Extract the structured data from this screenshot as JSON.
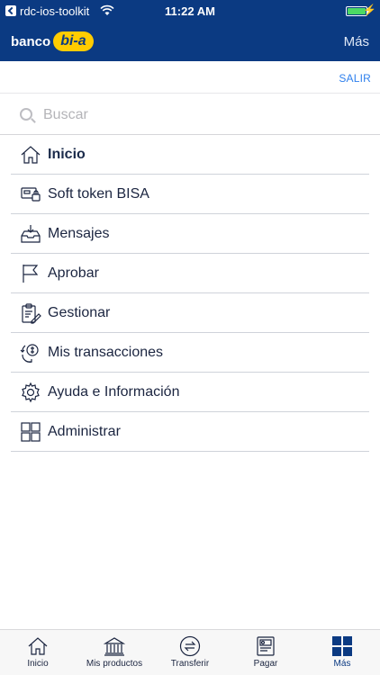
{
  "status_bar": {
    "carrier": "rdc-ios-toolkit",
    "time": "11:22 AM"
  },
  "header": {
    "logo_word": "banco",
    "logo_brand": "bi-a",
    "more_link": "Más"
  },
  "subheader": {
    "logout_label": "SALIR"
  },
  "search": {
    "placeholder": "Buscar",
    "value": ""
  },
  "menu": {
    "items": [
      {
        "label": "Inicio",
        "icon": "home-icon"
      },
      {
        "label": "Soft token BISA",
        "icon": "token-icon"
      },
      {
        "label": "Mensajes",
        "icon": "inbox-icon"
      },
      {
        "label": "Aprobar",
        "icon": "flag-icon"
      },
      {
        "label": "Gestionar",
        "icon": "clipboard-edit-icon"
      },
      {
        "label": "Mis transacciones",
        "icon": "transactions-icon"
      },
      {
        "label": "Ayuda e Información",
        "icon": "gear-icon"
      },
      {
        "label": "Administrar",
        "icon": "grid-icon"
      }
    ]
  },
  "tabbar": {
    "tabs": [
      {
        "label": "Inicio",
        "icon": "home-icon"
      },
      {
        "label": "Mis productos",
        "icon": "bank-icon"
      },
      {
        "label": "Transferir",
        "icon": "transfer-icon"
      },
      {
        "label": "Pagar",
        "icon": "bill-icon"
      },
      {
        "label": "Más",
        "icon": "grid-icon"
      }
    ]
  },
  "colors": {
    "brand_blue": "#0b3a82",
    "brand_yellow": "#ffcc00",
    "link_blue": "#2f80ed"
  }
}
